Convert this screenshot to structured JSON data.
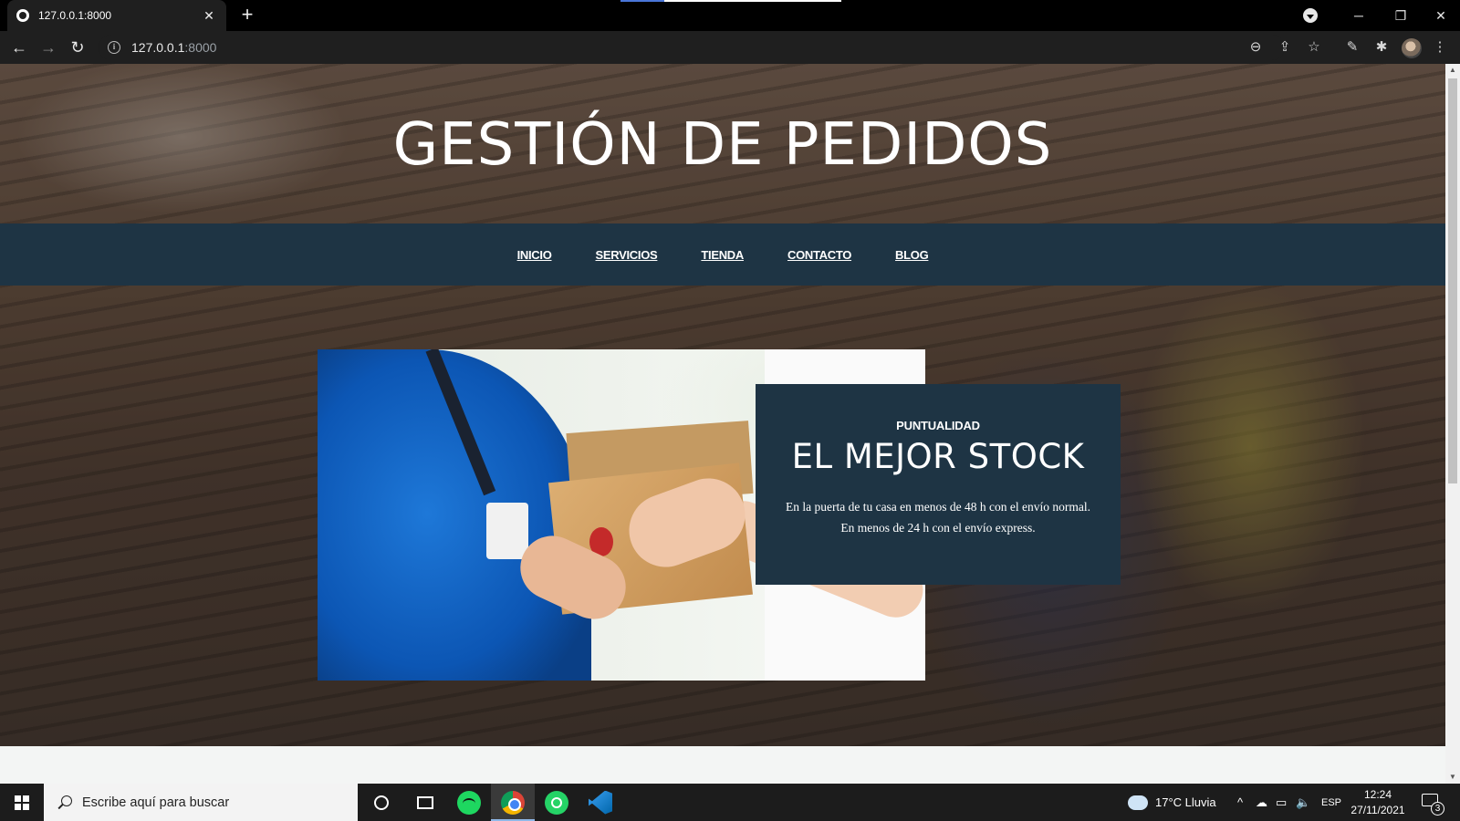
{
  "browser": {
    "tab_title": "127.0.0.1:8000",
    "tab_close": "✕",
    "new_tab": "+",
    "address_host": "127.0.0.1",
    "address_port": ":8000",
    "back": "←",
    "forward": "→",
    "reload": "↻",
    "window_controls": {
      "minimize": "─",
      "restore": "❐",
      "close": "✕"
    },
    "toolbar_icons": {
      "zoom": "⊖",
      "share": "⇪",
      "bookmark": "☆",
      "extension_a": "✎",
      "extensions": "✱",
      "menu": "⋮"
    }
  },
  "site": {
    "title": "GESTIÓN DE PEDIDOS",
    "nav": [
      "INICIO",
      "SERVICIOS",
      "TIENDA",
      "CONTACTO",
      "BLOG"
    ],
    "feature": {
      "eyebrow": "PUNTUALIDAD",
      "headline": "EL MEJOR STOCK",
      "body": "En la puerta de tu casa en menos de 48 h con el envío normal. En menos de 24 h con el envío express."
    },
    "colors": {
      "nav_bg": "#1e3444",
      "card_bg": "#1e3444",
      "page_bg": "#f3f5f4"
    }
  },
  "taskbar": {
    "search_placeholder": "Escribe aquí para buscar",
    "apps": [
      "cortana-icon",
      "task-view-icon",
      "spotify-icon",
      "chrome-icon",
      "whatsapp-icon",
      "vscode-icon"
    ],
    "weather": "17°C  Lluvia",
    "language": "ESP",
    "time": "12:24",
    "date": "27/11/2021",
    "notification_count": "3",
    "tray_glyphs": {
      "chevron": "^",
      "cloud": "☁",
      "network": "▭",
      "volume": "🔈"
    }
  }
}
